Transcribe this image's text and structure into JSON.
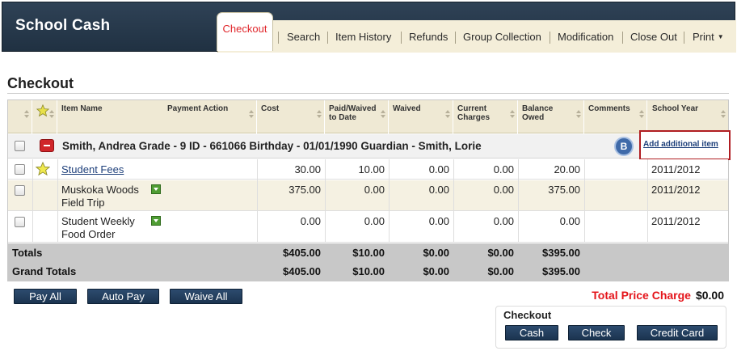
{
  "app": {
    "title": "School Cash"
  },
  "tabs": {
    "active": "Checkout",
    "items": [
      "Search",
      "Item History",
      "Refunds",
      "Group Collection",
      "Modification",
      "Close Out",
      "Print"
    ]
  },
  "page": {
    "title": "Checkout"
  },
  "table": {
    "headers": {
      "item_name": "Item Name",
      "payment_action": "Payment Action",
      "cost": "Cost",
      "paid_waived": "Paid/Waived\nto Date",
      "waived": "Waived",
      "current_charges": "Current\nCharges",
      "balance_owed": "Balance\nOwed",
      "comments": "Comments",
      "school_year": "School Year"
    },
    "student_row": {
      "text": "Smith, Andrea Grade - 9 ID - 661066 Birthday - 01/01/1990 Guardian - Smith, Lorie",
      "badge": "B",
      "add_link": "Add additional item"
    },
    "rows": [
      {
        "name": "Student Fees",
        "is_link": true,
        "starred": true,
        "cost": "30.00",
        "paid": "10.00",
        "waived": "0.00",
        "current": "0.00",
        "balance": "20.00",
        "comments": "",
        "year": "2011/2012"
      },
      {
        "name": "Muskoka Woods\nField Trip",
        "is_link": false,
        "starred": false,
        "cost": "375.00",
        "paid": "0.00",
        "waived": "0.00",
        "current": "0.00",
        "balance": "375.00",
        "comments": "",
        "year": "2011/2012"
      },
      {
        "name": "Student Weekly\nFood Order",
        "is_link": false,
        "starred": false,
        "cost": "0.00",
        "paid": "0.00",
        "waived": "0.00",
        "current": "0.00",
        "balance": "0.00",
        "comments": "",
        "year": "2011/2012"
      }
    ],
    "totals": {
      "label": "Totals",
      "cost": "$405.00",
      "paid": "$10.00",
      "waived": "$0.00",
      "current": "$0.00",
      "balance": "$395.00"
    },
    "grand_totals": {
      "label": "Grand Totals",
      "cost": "$405.00",
      "paid": "$10.00",
      "waived": "$0.00",
      "current": "$0.00",
      "balance": "$395.00"
    }
  },
  "actions": {
    "pay_all": "Pay All",
    "auto_pay": "Auto Pay",
    "waive_all": "Waive All"
  },
  "total_charge": {
    "label": "Total Price Charge",
    "value": "$0.00"
  },
  "checkout_panel": {
    "title": "Checkout",
    "cash": "Cash",
    "check": "Check",
    "credit_card": "Credit Card"
  },
  "colors": {
    "header_bg": "#2f4256",
    "tab_bg": "#f4eed9",
    "active_tab_text": "#e0262b",
    "button_bg": "#1f3a5a",
    "highlight_border": "#b01d22",
    "total_label": "#e4151b"
  }
}
